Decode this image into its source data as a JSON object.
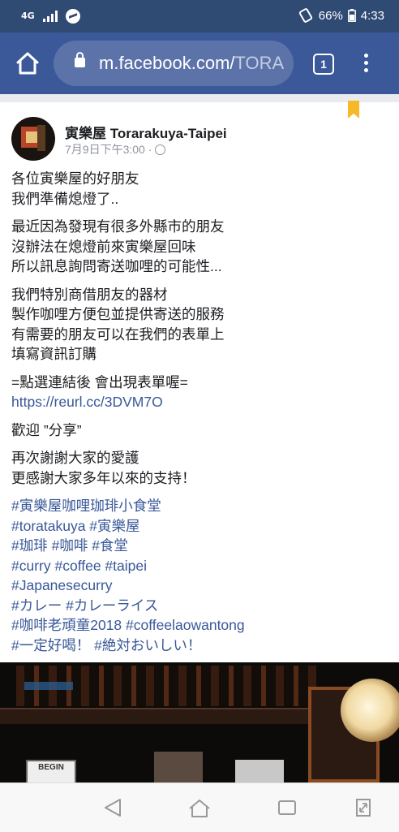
{
  "status_bar": {
    "network": "4G",
    "battery": "66%",
    "time": "4:33"
  },
  "browser": {
    "url_main": "m.facebook.com/",
    "url_dim": "TORA",
    "tab_count": "1"
  },
  "post": {
    "page_name": "寅樂屋 Torarakuya-Taipei",
    "timestamp": "7月9日下午3:00 ·",
    "paragraphs": [
      [
        "各位寅樂屋的好朋友",
        "我們準備熄燈了.."
      ],
      [
        "最近因為發現有很多外縣市的朋友",
        "沒辦法在熄燈前來寅樂屋回味",
        "所以訊息詢問寄送咖哩的可能性..."
      ],
      [
        "我們特別商借朋友的器材",
        "製作咖哩方便包並提供寄送的服務",
        "有需要的朋友可以在我們的表單上",
        "填寫資訊訂購"
      ]
    ],
    "link_intro": "=點選連結後 會出現表單喔=",
    "link": "https://reurl.cc/3DVM7O",
    "share_line": "歡迎 ”分享”",
    "thanks": [
      "再次謝謝大家的愛護",
      "更感謝大家多年以來的支持！"
    ],
    "hashtags": [
      "#寅樂屋咖哩珈琲小食堂",
      "#toratakuya #寅樂屋",
      "#珈琲 #咖啡 #食堂",
      "#curry #coffee #taipei",
      "#Japanesecurry",
      "#カレー #カレーライス",
      "#咖啡老頑童2018 #coffeelaowantong",
      "#一定好喝！ #絶対おいしい！"
    ],
    "photo_sign": "BEGIN"
  }
}
